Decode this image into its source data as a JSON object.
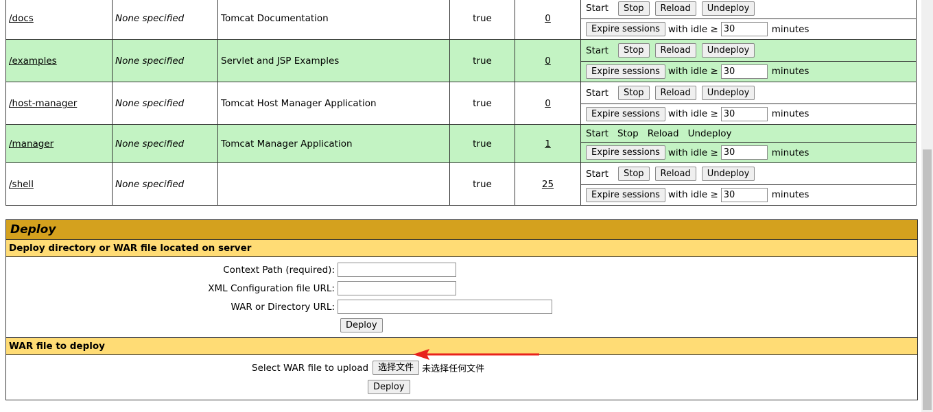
{
  "applications": [
    {
      "path": "/docs",
      "version": "None specified",
      "display_name": "Tomcat Documentation",
      "running": "true",
      "sessions": "0",
      "commands": {
        "start": "Start",
        "stop": "Stop",
        "reload": "Reload",
        "undeploy": "Undeploy"
      }
    },
    {
      "path": "/examples",
      "version": "None specified",
      "display_name": "Servlet and JSP Examples",
      "running": "true",
      "sessions": "0",
      "commands": {
        "start": "Start",
        "stop": "Stop",
        "reload": "Reload",
        "undeploy": "Undeploy"
      }
    },
    {
      "path": "/host-manager",
      "version": "None specified",
      "display_name": "Tomcat Host Manager Application",
      "running": "true",
      "sessions": "0",
      "commands": {
        "start": "Start",
        "stop": "Stop",
        "reload": "Reload",
        "undeploy": "Undeploy"
      }
    },
    {
      "path": "/manager",
      "version": "None specified",
      "display_name": "Tomcat Manager Application",
      "running": "true",
      "sessions": "1",
      "commands": {
        "start": "Start",
        "stop": "Stop",
        "reload": "Reload",
        "undeploy": "Undeploy"
      }
    },
    {
      "path": "/shell",
      "version": "None specified",
      "display_name": "",
      "running": "true",
      "sessions": "25",
      "commands": {
        "start": "Start",
        "stop": "Stop",
        "reload": "Reload",
        "undeploy": "Undeploy"
      }
    }
  ],
  "expire": {
    "button": "Expire sessions",
    "with_idle": "with idle ≥",
    "value": "30",
    "minutes": "minutes"
  },
  "deploy": {
    "title": "Deploy",
    "server_section": "Deploy directory or WAR file located on server",
    "context_path_label": "Context Path (required):",
    "xml_config_label": "XML Configuration file URL:",
    "war_dir_label": "WAR or Directory URL:",
    "deploy_button": "Deploy",
    "war_section": "WAR file to deploy",
    "select_label": "Select WAR file to upload",
    "choose_file_button": "选择文件",
    "no_file_text": "未选择任何文件",
    "upload_deploy_button": "Deploy"
  },
  "colors": {
    "green_row": "#c3f3c3",
    "deploy_title": "#d4a11e",
    "deploy_sub": "#ffdc75",
    "arrow": "#e8221b"
  }
}
